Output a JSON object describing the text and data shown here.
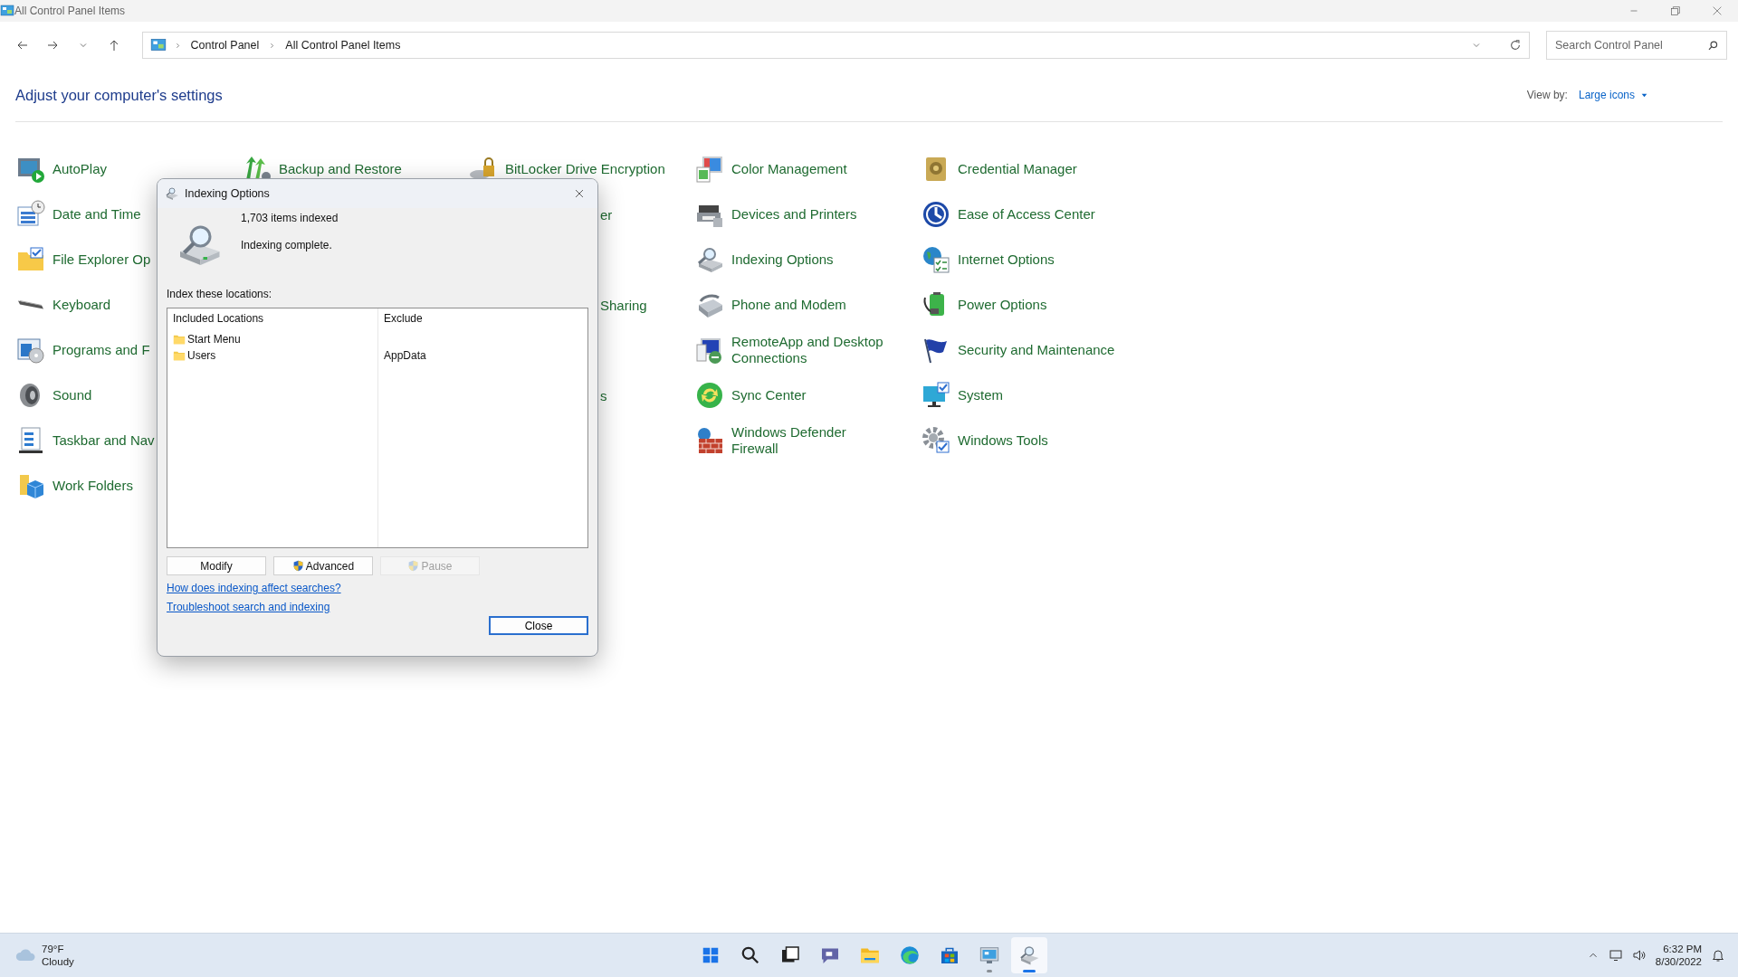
{
  "window": {
    "title": "All Control Panel Items"
  },
  "address_bar": {
    "breadcrumbs": [
      "Control Panel",
      "All Control Panel Items"
    ]
  },
  "search": {
    "placeholder": "Search Control Panel"
  },
  "heading": "Adjust your computer's settings",
  "view_by": {
    "label": "View by:",
    "value": "Large icons"
  },
  "grid_rows": [
    [
      {
        "kind": "item",
        "label": "AutoPlay"
      },
      {
        "kind": "item",
        "label": "Backup and Restore"
      },
      {
        "kind": "item",
        "label": "BitLocker Drive Encryption"
      },
      {
        "kind": "item",
        "label": "Color Management"
      },
      {
        "kind": "item",
        "label": "Credential Manager"
      }
    ],
    [
      {
        "kind": "item",
        "label": "Date and Time"
      },
      null,
      {
        "kind": "fragment",
        "label": "er"
      },
      {
        "kind": "item",
        "label": "Devices and Printers"
      },
      {
        "kind": "item",
        "label": "Ease of Access Center"
      }
    ],
    [
      {
        "kind": "item",
        "label": "File Explorer Op"
      },
      null,
      null,
      {
        "kind": "item",
        "label": "Indexing Options"
      },
      {
        "kind": "item",
        "label": "Internet Options"
      }
    ],
    [
      {
        "kind": "item",
        "label": "Keyboard"
      },
      null,
      {
        "kind": "fragment",
        "label": "Sharing"
      },
      {
        "kind": "item",
        "label": "Phone and Modem"
      },
      {
        "kind": "item",
        "label": "Power Options"
      }
    ],
    [
      {
        "kind": "item",
        "label": "Programs and F"
      },
      null,
      null,
      {
        "kind": "item",
        "label": "RemoteApp and Desktop Connections"
      },
      {
        "kind": "item",
        "label": "Security and Maintenance"
      }
    ],
    [
      {
        "kind": "item",
        "label": "Sound"
      },
      null,
      {
        "kind": "fragment",
        "label": "s"
      },
      {
        "kind": "item",
        "label": "Sync Center"
      },
      {
        "kind": "item",
        "label": "System"
      }
    ],
    [
      {
        "kind": "item",
        "label": "Taskbar and Nav"
      },
      null,
      null,
      {
        "kind": "item",
        "label": "Windows Defender Firewall"
      },
      {
        "kind": "item",
        "label": "Windows Tools"
      }
    ],
    [
      {
        "kind": "item",
        "label": "Work Folders"
      },
      null,
      null,
      null,
      null
    ]
  ],
  "dialog": {
    "title": "Indexing Options",
    "count": "1,703 items indexed",
    "status": "Indexing complete.",
    "locations_label": "Index these locations:",
    "columns": [
      "Included Locations",
      "Exclude"
    ],
    "locations": [
      {
        "included": "Start Menu"
      },
      {
        "included": "Users",
        "exclude": "AppData"
      }
    ],
    "buttons": [
      {
        "label": "Modify",
        "kind": "plain",
        "disabled": false
      },
      {
        "label": "Advanced",
        "kind": "shield",
        "disabled": false
      },
      {
        "label": "Pause",
        "kind": "shield",
        "disabled": true
      }
    ],
    "links": [
      "How does indexing affect searches?",
      "Troubleshoot search and indexing"
    ],
    "close_button": {
      "label": "Close",
      "default": true
    }
  },
  "taskbar": {
    "weather": {
      "temperature": "79°F",
      "condition": "Cloudy"
    },
    "apps": [
      {
        "running": false,
        "selected": false
      },
      {
        "running": false,
        "selected": false
      },
      {
        "running": false,
        "selected": false
      },
      {
        "running": false,
        "selected": false
      },
      {
        "running": false,
        "selected": false
      },
      {
        "running": false,
        "selected": false
      },
      {
        "running": false,
        "selected": false
      },
      {
        "running": true,
        "selected": false
      },
      {
        "running": true,
        "selected": true
      }
    ],
    "clock": {
      "time": "6:32 PM",
      "date": "8/30/2022"
    }
  }
}
